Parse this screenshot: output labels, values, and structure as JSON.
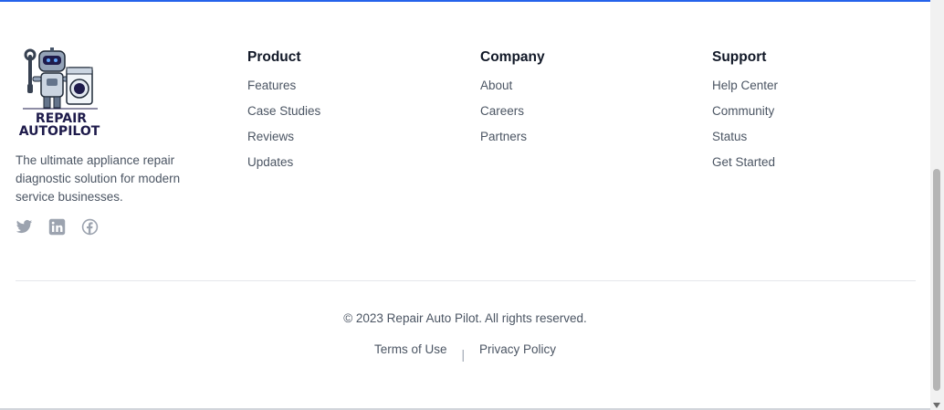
{
  "brand": {
    "logo_text_line1": "REPAIR",
    "logo_text_line2": "AUTOPILOT",
    "tagline": "The ultimate appliance repair diagnostic solution for modern service businesses."
  },
  "social_icons": [
    "twitter-icon",
    "linkedin-icon",
    "facebook-icon"
  ],
  "columns": {
    "product": {
      "heading": "Product",
      "links": [
        "Features",
        "Case Studies",
        "Reviews",
        "Updates"
      ]
    },
    "company": {
      "heading": "Company",
      "links": [
        "About",
        "Careers",
        "Partners"
      ]
    },
    "support": {
      "heading": "Support",
      "links": [
        "Help Center",
        "Community",
        "Status",
        "Get Started"
      ]
    }
  },
  "copyright": "© 2023 Repair Auto Pilot. All rights reserved.",
  "legal": {
    "terms": "Terms of Use",
    "separator": "|",
    "privacy": "Privacy Policy"
  },
  "colors": {
    "accent": "#2563eb",
    "logo_navy": "#1e1b4b",
    "muted_text": "#4b5563",
    "heading": "#111827",
    "icon_gray": "#9ca3af"
  }
}
